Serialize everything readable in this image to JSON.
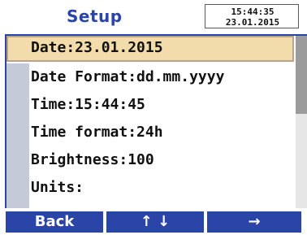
{
  "header": {
    "title": "Setup",
    "clock": {
      "time": "15:44:35",
      "date": "23.01.2015"
    }
  },
  "menu": {
    "items": [
      {
        "label": "Date:23.01.2015",
        "selected": true
      },
      {
        "label": "Date Format:dd.mm.yyyy",
        "selected": false
      },
      {
        "label": "Time:15:44:45",
        "selected": false
      },
      {
        "label": "Time format:24h",
        "selected": false
      },
      {
        "label": "Brightness:100",
        "selected": false
      },
      {
        "label": "Units:",
        "selected": false
      }
    ]
  },
  "softkeys": {
    "back": "Back",
    "updown": "↑ ↓",
    "right": "→"
  },
  "colors": {
    "accent": "#2b44a8",
    "selection": "#f2dcab"
  }
}
